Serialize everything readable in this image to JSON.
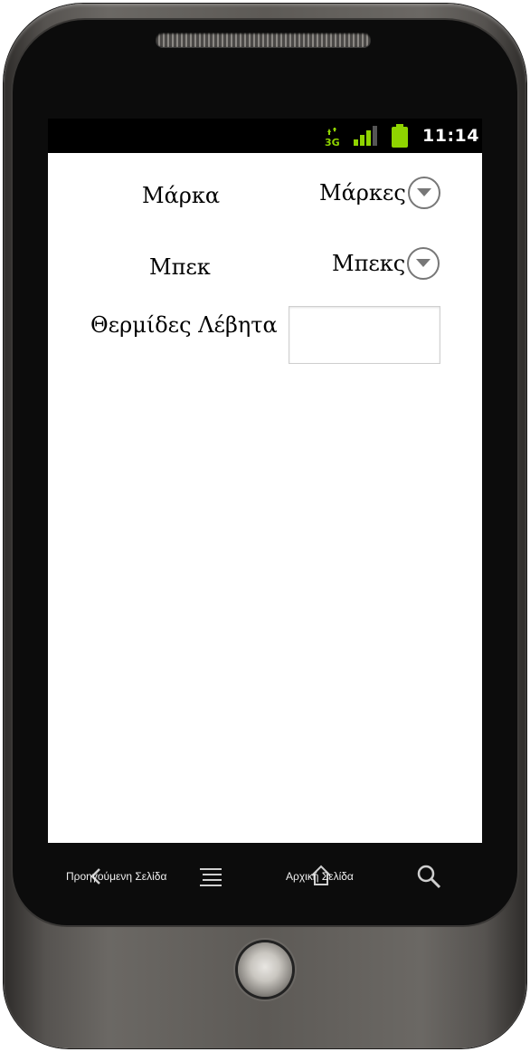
{
  "status_bar": {
    "network": "3G",
    "time": "11:14",
    "icons": [
      "3g-data-icon",
      "signal-icon",
      "battery-icon"
    ]
  },
  "form": {
    "brand": {
      "label": "Μάρκα",
      "selected": "Μάρκες"
    },
    "burner": {
      "label": "Μπεκ",
      "selected": "Μπεκς"
    },
    "boiler_calories": {
      "label": "Θερμίδες Λέβητα",
      "value": "",
      "placeholder": ""
    }
  },
  "nav": {
    "back_label": "Προηγούμενη Σελίδα",
    "home_label": "Αρχική Σελίδα",
    "icons": [
      "back-icon",
      "menu-icon",
      "home-icon",
      "search-icon"
    ]
  },
  "colors": {
    "screen_bg": "#ffffff",
    "status_bar_bg": "#000000",
    "status_green": "#8fd400",
    "dropdown_arrow": "#777777"
  }
}
